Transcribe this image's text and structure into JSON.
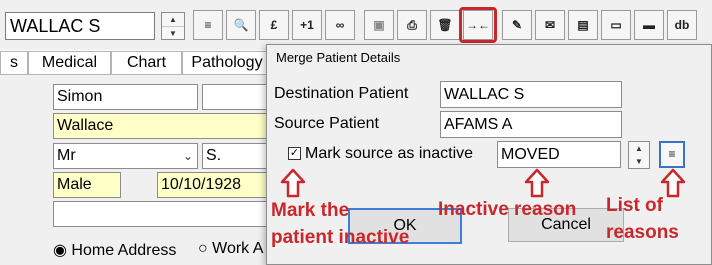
{
  "toolbar": {
    "patient_value": "WALLAC S",
    "spin_up": "▲",
    "spin_down": "▼",
    "buttons": [
      {
        "icon": "list-icon",
        "glyph": "≡"
      },
      {
        "icon": "search-icon",
        "glyph": "🔍"
      },
      {
        "icon": "pound-icon",
        "glyph": "£"
      },
      {
        "icon": "plus-one-icon",
        "glyph": "+1"
      },
      {
        "icon": "link-icon",
        "glyph": "∞"
      },
      {
        "icon": "save-icon",
        "glyph": "▣"
      },
      {
        "icon": "print-icon",
        "glyph": "⎙"
      },
      {
        "icon": "trash-icon",
        "glyph": "🗑"
      },
      {
        "icon": "merge-icon",
        "glyph": "→←"
      },
      {
        "icon": "pen-icon",
        "glyph": "✎"
      },
      {
        "icon": "letter-icon",
        "glyph": "✉"
      },
      {
        "icon": "document-icon",
        "glyph": "▤"
      },
      {
        "icon": "card-icon",
        "glyph": "▭"
      },
      {
        "icon": "note-icon",
        "glyph": "▬"
      },
      {
        "icon": "database-icon",
        "glyph": "db"
      }
    ],
    "highlight_color": "#c8282c"
  },
  "tabs": [
    "s",
    "Medical",
    "Chart",
    "Pathology"
  ],
  "form": {
    "first_name": "Simon",
    "surname": "Wallace",
    "title": "Mr",
    "initial": "S.",
    "gender": "Male",
    "dob": "10/10/1928",
    "home_address": "Home Address",
    "work_address": "Work A",
    "chevron": "⌄"
  },
  "dialog": {
    "title": "Merge Patient Details",
    "destination_label": "Destination Patient",
    "destination_value": "WALLAC S",
    "source_label": "Source Patient",
    "source_value": "AFAMS A",
    "checkbox_mark": "✓",
    "inactive_label": "Mark source as inactive",
    "reason_value": "MOVED",
    "ok_label": "OK",
    "cancel_label": "Cancel",
    "list_glyph": "≡"
  },
  "annotations": {
    "mark_inactive": [
      "Mark the",
      "patient inactive"
    ],
    "inactive_reason": "Inactive reason",
    "list_of_reasons": [
      "List of",
      "reasons"
    ],
    "color": "#c8282c"
  }
}
